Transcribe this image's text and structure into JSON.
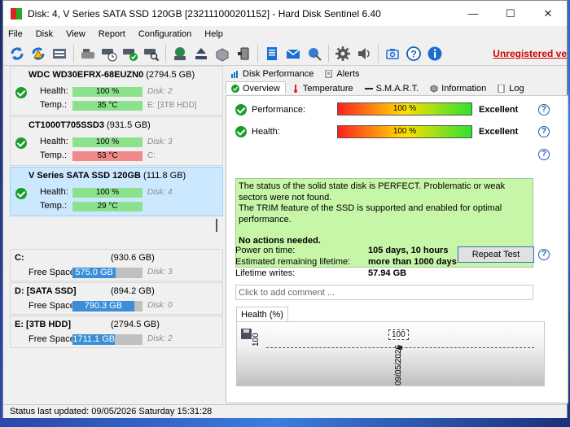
{
  "window": {
    "title": "Disk: 4, V Series SATA SSD 120GB [232111000201152]  -  Hard Disk Sentinel 6.40",
    "minimize": "—",
    "maximize": "☐",
    "close": "✕"
  },
  "menu": [
    "File",
    "Disk",
    "View",
    "Report",
    "Configuration",
    "Help"
  ],
  "toolbar": {
    "unregistered": "Unregistered ve"
  },
  "disks": [
    {
      "name": "WDC WD30EFRX-68EUZN0",
      "size": "(2794.5 GB)",
      "health": "100 %",
      "temp": "35 °C",
      "health_right": "Disk: 2",
      "temp_right": "E: [3TB HDD]",
      "health_label": "Health:",
      "temp_label": "Temp.:",
      "temp_color": "green"
    },
    {
      "name": "CT1000T705SSD3",
      "size": "(931.5 GB)",
      "health": "100 %",
      "temp": "53 °C",
      "health_right": "Disk: 3",
      "temp_right": "C:",
      "health_label": "Health:",
      "temp_label": "Temp.:",
      "temp_color": "red"
    },
    {
      "name": "V Series SATA SSD 120GB",
      "size": "(111.8 GB)",
      "health": "100 %",
      "temp": "29 °C",
      "health_right": "Disk: 4",
      "temp_right": "",
      "health_label": "Health:",
      "temp_label": "Temp.:",
      "temp_color": "green"
    }
  ],
  "partitions": [
    {
      "name": "C:",
      "size": "(930.6 GB)",
      "free_label": "Free Space",
      "free": "575.0 GB",
      "free_fraction": 0.62,
      "disk": "Disk: 3"
    },
    {
      "name": "D: [SATA SSD]",
      "size": "(894.2 GB)",
      "free_label": "Free Space",
      "free": "790.3 GB",
      "free_fraction": 0.88,
      "disk": "Disk: 0"
    },
    {
      "name": "E: [3TB HDD]",
      "size": "(2794.5 GB)",
      "free_label": "Free Space",
      "free": "1711.1 GB",
      "free_fraction": 0.61,
      "disk": "Disk: 2"
    }
  ],
  "tabs_top": [
    "Disk Performance",
    "Alerts"
  ],
  "tabs_bottom": [
    "Overview",
    "Temperature",
    "S.M.A.R.T.",
    "Information",
    "Log"
  ],
  "overview": {
    "performance_label": "Performance:",
    "performance_value": "100 %",
    "performance_rating": "Excellent",
    "health_label": "Health:",
    "health_value": "100 %",
    "health_rating": "Excellent",
    "status_line1": "The status of the solid state disk is PERFECT. Problematic or weak sectors were not found.",
    "status_line2": "The TRIM feature of the SSD is supported and enabled for optimal performance.",
    "status_line3": "No actions needed.",
    "power_on_label": "Power on time:",
    "power_on_value": "105 days, 10 hours",
    "remaining_label": "Estimated remaining lifetime:",
    "remaining_value": "more than 1000 days",
    "writes_label": "Lifetime writes:",
    "writes_value": "57.94 GB",
    "repeat_button": "Repeat Test",
    "comment_placeholder": "Click to add comment ...",
    "help": "?"
  },
  "health_chart": {
    "tab_label": "Health (%)",
    "y_label": "100",
    "point_label": "100",
    "date_label": "09/05/2026"
  },
  "chart_data": {
    "type": "line",
    "x": [
      "09/05/2026"
    ],
    "series": [
      {
        "values": [
          100
        ]
      }
    ],
    "title": "Health (%)"
  },
  "statusbar": {
    "text": "Status last updated: 09/05/2026 Saturday 15:31:28"
  }
}
